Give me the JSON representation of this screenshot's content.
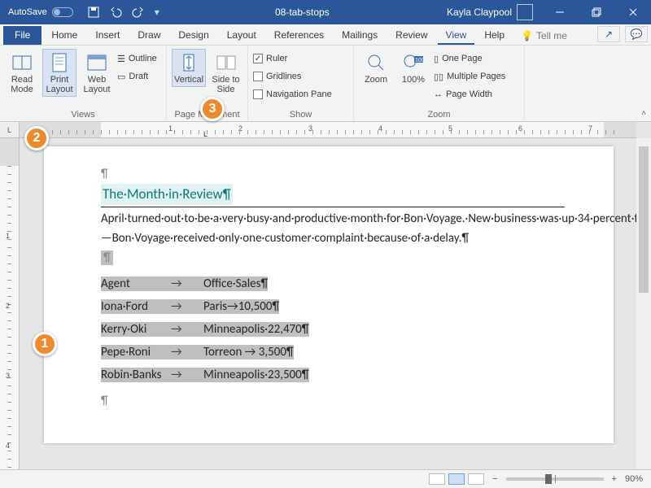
{
  "titlebar": {
    "autosave": "AutoSave",
    "doc_title": "08-tab-stops",
    "user": "Kayla Claypool"
  },
  "tabs": {
    "file": "File",
    "items": [
      "Home",
      "Insert",
      "Draw",
      "Design",
      "Layout",
      "References",
      "Mailings",
      "Review",
      "View",
      "Help"
    ],
    "active": "View",
    "tellme": "Tell me"
  },
  "ribbon": {
    "views": {
      "read": "Read Mode",
      "print": "Print Layout",
      "web": "Web Layout",
      "outline": "Outline",
      "draft": "Draft",
      "label": "Views"
    },
    "movement": {
      "vertical": "Vertical",
      "side": "Side to Side",
      "label": "Page Movement"
    },
    "show": {
      "ruler": "Ruler",
      "gridlines": "Gridlines",
      "nav": "Navigation Pane",
      "label": "Show"
    },
    "zoom": {
      "zoom": "Zoom",
      "hundred": "100%",
      "one": "One Page",
      "multi": "Multiple Pages",
      "width": "Page Width",
      "label": "Zoom"
    }
  },
  "document": {
    "heading": "The·Month·in·Review¶",
    "body": "April·turned·out·to·be·a·very·busy·and·productive·month·for·Bon·Voyage.·New·business·was·up·34·percent·from·last·April.·Flight·delays·were·minimal—Bon·Voyage·received·only·one·customer·complaint·because·of·a·delay.¶",
    "rows": [
      {
        "c1": "Agent",
        "c2": "Office·Sales¶"
      },
      {
        "c1": "Iona·Ford",
        "c2": "Paris→10,500¶"
      },
      {
        "c1": "Kerry·Oki",
        "c2": "Minneapolis·22,470¶"
      },
      {
        "c1": "Pepe·Roni",
        "c2": "Torreon → 3,500¶"
      },
      {
        "c1": "Robin·Banks",
        "c2": "Minneapolis·23,500¶"
      }
    ]
  },
  "status": {
    "zoom": "90%"
  },
  "callouts": {
    "1": "1",
    "2": "2",
    "3": "3"
  },
  "ruler_nums": [
    "1",
    "2",
    "3",
    "4",
    "5",
    "6",
    "7"
  ]
}
